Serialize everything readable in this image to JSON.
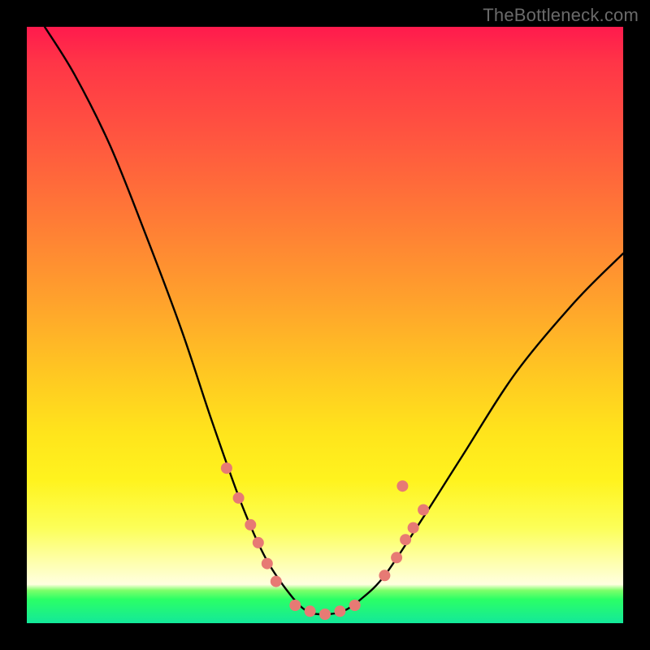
{
  "watermark": "TheBottleneck.com",
  "chart_data": {
    "type": "line",
    "title": "",
    "xlabel": "",
    "ylabel": "",
    "xlim": [
      0,
      100
    ],
    "ylim": [
      0,
      100
    ],
    "gradient_stops": [
      {
        "pct": 0,
        "color": "#ff1a4d"
      },
      {
        "pct": 6,
        "color": "#ff3547"
      },
      {
        "pct": 18,
        "color": "#ff5440"
      },
      {
        "pct": 32,
        "color": "#ff7a36"
      },
      {
        "pct": 46,
        "color": "#ffa22c"
      },
      {
        "pct": 58,
        "color": "#ffc722"
      },
      {
        "pct": 68,
        "color": "#ffe41c"
      },
      {
        "pct": 76,
        "color": "#fff31e"
      },
      {
        "pct": 84,
        "color": "#fcff58"
      },
      {
        "pct": 90,
        "color": "#feffb0"
      },
      {
        "pct": 93.5,
        "color": "#ffffe0"
      },
      {
        "pct": 94.5,
        "color": "#7dff6a"
      },
      {
        "pct": 96,
        "color": "#2bff66"
      },
      {
        "pct": 100,
        "color": "#13e89a"
      }
    ],
    "series": [
      {
        "name": "bottleneck-curve",
        "stroke": "#000000",
        "points": [
          {
            "x": 3,
            "y": 100
          },
          {
            "x": 8,
            "y": 92
          },
          {
            "x": 14,
            "y": 80
          },
          {
            "x": 20,
            "y": 65
          },
          {
            "x": 26,
            "y": 49
          },
          {
            "x": 31,
            "y": 34
          },
          {
            "x": 36,
            "y": 20
          },
          {
            "x": 40,
            "y": 11
          },
          {
            "x": 44,
            "y": 5
          },
          {
            "x": 47,
            "y": 2
          },
          {
            "x": 50,
            "y": 1.5
          },
          {
            "x": 53,
            "y": 2
          },
          {
            "x": 56,
            "y": 4
          },
          {
            "x": 60,
            "y": 8
          },
          {
            "x": 66,
            "y": 17
          },
          {
            "x": 73,
            "y": 28
          },
          {
            "x": 82,
            "y": 42
          },
          {
            "x": 92,
            "y": 54
          },
          {
            "x": 100,
            "y": 62
          }
        ]
      }
    ],
    "markers": {
      "color": "#e77a74",
      "radius": 7,
      "points": [
        {
          "x": 33.5,
          "y": 26
        },
        {
          "x": 35.5,
          "y": 21
        },
        {
          "x": 37.5,
          "y": 16.5
        },
        {
          "x": 38.8,
          "y": 13.5
        },
        {
          "x": 40.3,
          "y": 10
        },
        {
          "x": 41.8,
          "y": 7
        },
        {
          "x": 45.0,
          "y": 3
        },
        {
          "x": 47.5,
          "y": 2
        },
        {
          "x": 50.0,
          "y": 1.5
        },
        {
          "x": 52.5,
          "y": 2
        },
        {
          "x": 55.0,
          "y": 3
        },
        {
          "x": 60.0,
          "y": 8
        },
        {
          "x": 62.0,
          "y": 11
        },
        {
          "x": 63.5,
          "y": 14
        },
        {
          "x": 64.8,
          "y": 16
        },
        {
          "x": 66.5,
          "y": 19
        },
        {
          "x": 63.0,
          "y": 23
        }
      ]
    }
  }
}
